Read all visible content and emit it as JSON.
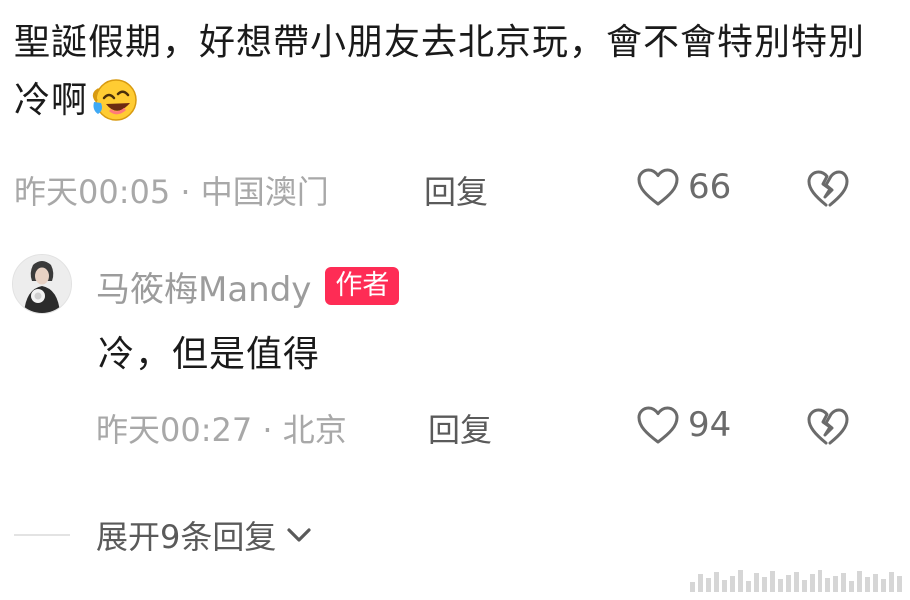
{
  "comment": {
    "text": "聖誕假期，好想帶小朋友去北京玩，會不會特別特別冷啊",
    "emoji": "laughing-crying-emoji",
    "time_location": "昨天00:05 · 中国澳门",
    "reply_label": "回复",
    "like_count": "66"
  },
  "reply": {
    "author_name": "马筱梅Mandy",
    "author_badge": "作者",
    "text": "冷，但是值得",
    "time_location": "昨天00:27 · 北京",
    "reply_label": "回复",
    "like_count": "94"
  },
  "expand": {
    "label": "展开9条回复"
  },
  "icons": {
    "like": "heart-outline-icon",
    "dislike": "broken-heart-icon",
    "expand": "chevron-down-icon"
  },
  "colors": {
    "badge": "#fe2c55",
    "text": "#1a1a1a",
    "meta": "#a8a8a8",
    "action": "#5a5a5a",
    "icon": "#6b6b6b"
  }
}
